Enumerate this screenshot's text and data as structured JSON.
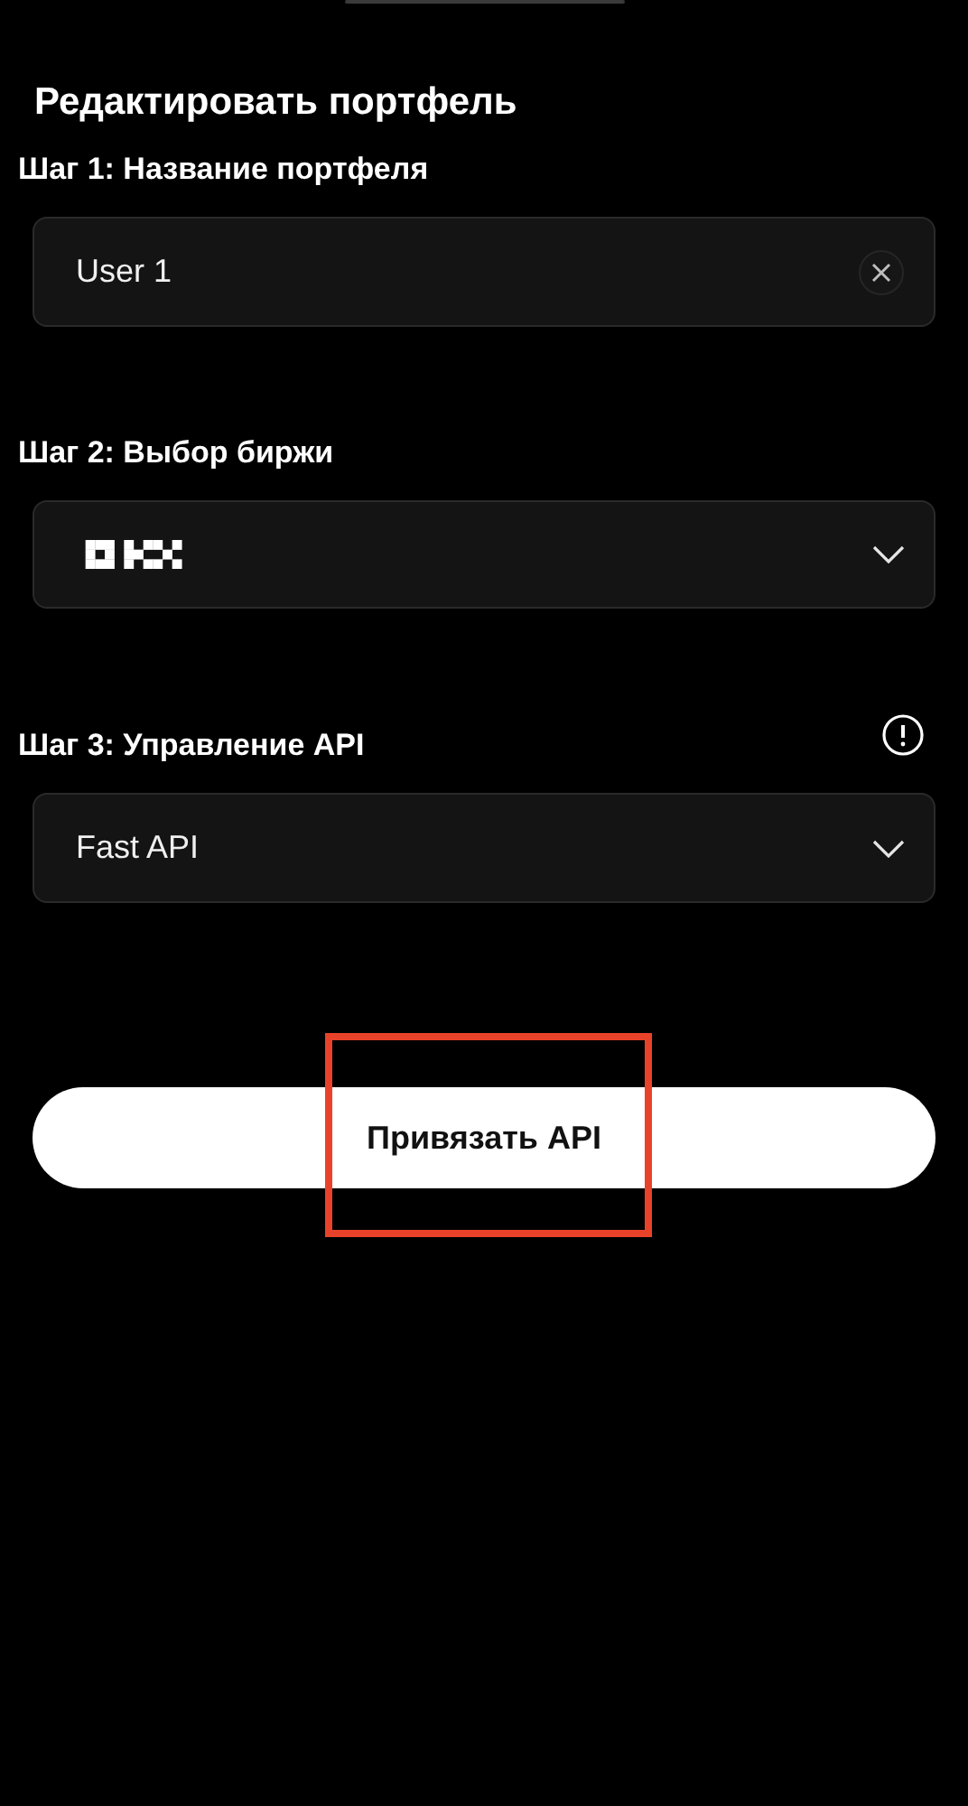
{
  "title": "Редактировать портфель",
  "steps": [
    {
      "label": "Шаг 1: Название портфеля",
      "kind": "text",
      "value": "User 1",
      "info": false
    },
    {
      "label": "Шаг 2: Выбор биржи",
      "kind": "logo-select",
      "info": false
    },
    {
      "label": "Шаг 3: Управление API",
      "kind": "select",
      "value": "Fast API",
      "info": true
    }
  ],
  "button": {
    "label": "Привязать API",
    "highlighted": true
  }
}
